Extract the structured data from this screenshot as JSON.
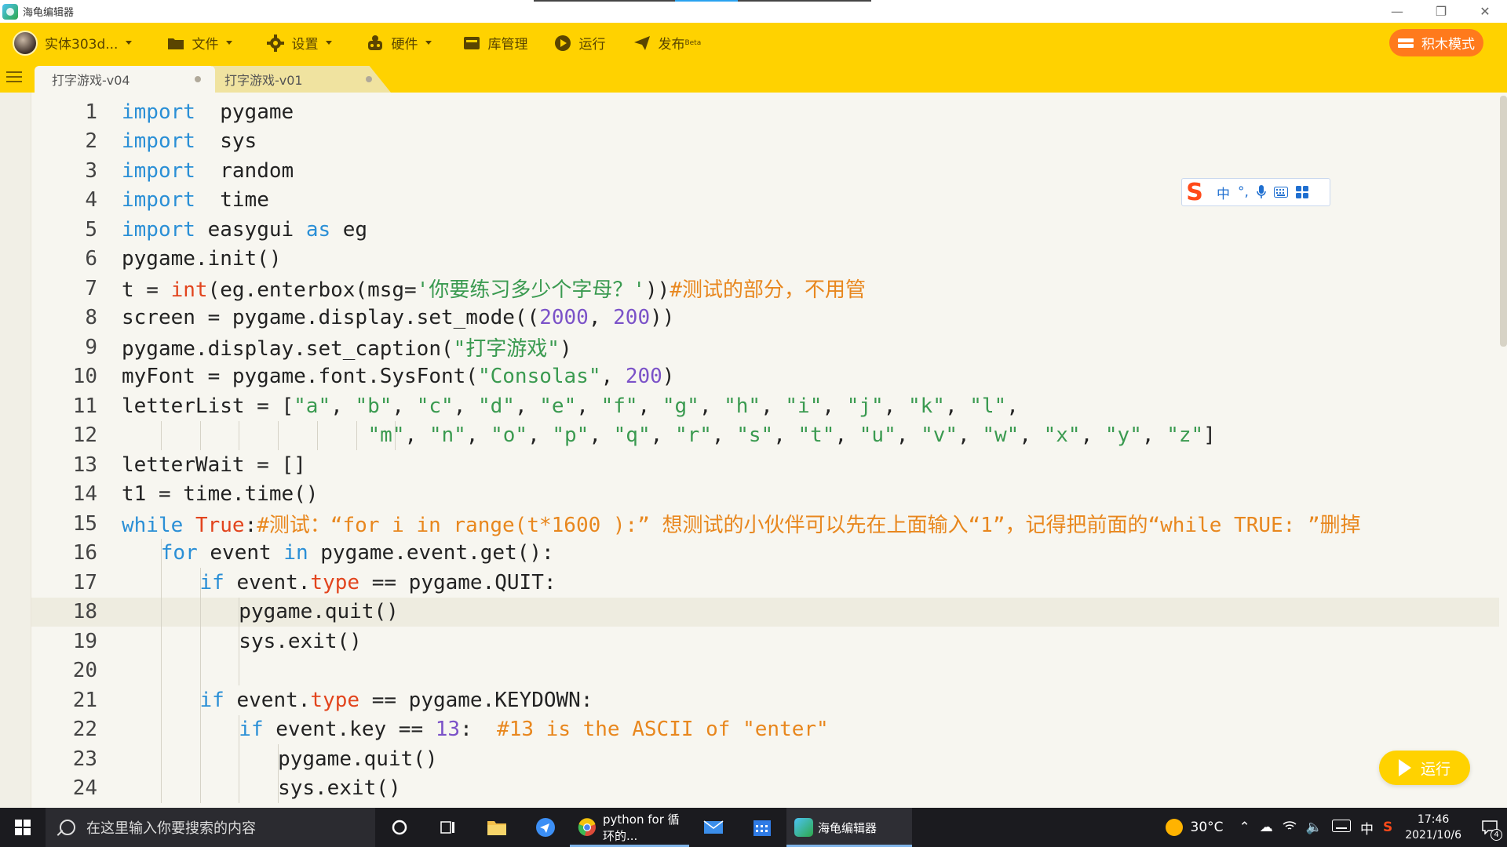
{
  "window": {
    "title": "海龟编辑器"
  },
  "toolbar": {
    "project_label": "实体303d...",
    "file_label": "文件",
    "settings_label": "设置",
    "hardware_label": "硬件",
    "library_label": "库管理",
    "run_label": "运行",
    "publish_label": "发布",
    "publish_badge": "Beta",
    "blocks_mode_label": "积木模式"
  },
  "tabs": [
    {
      "label": "打字游戏-v04",
      "active": true
    },
    {
      "label": "打字游戏-v01",
      "active": false
    }
  ],
  "editor": {
    "current_line": 18,
    "lines": [
      {
        "n": "1",
        "indent": 0,
        "tokens": [
          [
            "kw",
            "import"
          ],
          [
            "",
            "  pygame"
          ]
        ]
      },
      {
        "n": "2",
        "indent": 0,
        "tokens": [
          [
            "kw",
            "import"
          ],
          [
            "",
            "  sys"
          ]
        ]
      },
      {
        "n": "3",
        "indent": 0,
        "tokens": [
          [
            "kw",
            "import"
          ],
          [
            "",
            "  random"
          ]
        ]
      },
      {
        "n": "4",
        "indent": 0,
        "tokens": [
          [
            "kw",
            "import"
          ],
          [
            "",
            "  time"
          ]
        ]
      },
      {
        "n": "5",
        "indent": 0,
        "tokens": [
          [
            "kw",
            "import"
          ],
          [
            "",
            " easygui "
          ],
          [
            "kw",
            "as"
          ],
          [
            "",
            " eg"
          ]
        ]
      },
      {
        "n": "6",
        "indent": 0,
        "tokens": [
          [
            "",
            "pygame.init()"
          ]
        ]
      },
      {
        "n": "7",
        "indent": 0,
        "tokens": [
          [
            "",
            "t = "
          ],
          [
            "fn",
            "int"
          ],
          [
            "",
            "(eg.enterbox(msg="
          ],
          [
            "str",
            "'你要练习多少个字母？'"
          ],
          [
            "",
            "))"
          ],
          [
            "cmt",
            "#测试的部分，不用管"
          ]
        ]
      },
      {
        "n": "8",
        "indent": 0,
        "tokens": [
          [
            "",
            "screen = pygame.display.set_mode(("
          ],
          [
            "num",
            "2000"
          ],
          [
            "",
            ", "
          ],
          [
            "num",
            "200"
          ],
          [
            "",
            "))"
          ]
        ]
      },
      {
        "n": "9",
        "indent": 0,
        "tokens": [
          [
            "",
            "pygame.display.set_caption("
          ],
          [
            "str",
            "\"打字游戏\""
          ],
          [
            "",
            ")"
          ]
        ]
      },
      {
        "n": "10",
        "indent": 0,
        "tokens": [
          [
            "",
            "myFont = pygame.font.SysFont("
          ],
          [
            "str",
            "\"Consolas\""
          ],
          [
            "",
            ", "
          ],
          [
            "num",
            "200"
          ],
          [
            "",
            ")"
          ]
        ]
      },
      {
        "n": "11",
        "indent": 0,
        "tokens": [
          [
            "",
            "letterList = ["
          ],
          [
            "str",
            "\"a\""
          ],
          [
            "",
            ", "
          ],
          [
            "str",
            "\"b\""
          ],
          [
            "",
            ", "
          ],
          [
            "str",
            "\"c\""
          ],
          [
            "",
            ", "
          ],
          [
            "str",
            "\"d\""
          ],
          [
            "",
            ", "
          ],
          [
            "str",
            "\"e\""
          ],
          [
            "",
            ", "
          ],
          [
            "str",
            "\"f\""
          ],
          [
            "",
            ", "
          ],
          [
            "str",
            "\"g\""
          ],
          [
            "",
            ", "
          ],
          [
            "str",
            "\"h\""
          ],
          [
            "",
            ", "
          ],
          [
            "str",
            "\"i\""
          ],
          [
            "",
            ", "
          ],
          [
            "str",
            "\"j\""
          ],
          [
            "",
            ", "
          ],
          [
            "str",
            "\"k\""
          ],
          [
            "",
            ", "
          ],
          [
            "str",
            "\"l\""
          ],
          [
            "",
            ","
          ]
        ]
      },
      {
        "n": "12",
        "indent": 7,
        "tokens": [
          [
            "str",
            "\"m\""
          ],
          [
            "",
            ", "
          ],
          [
            "str",
            "\"n\""
          ],
          [
            "",
            ", "
          ],
          [
            "str",
            "\"o\""
          ],
          [
            "",
            ", "
          ],
          [
            "str",
            "\"p\""
          ],
          [
            "",
            ", "
          ],
          [
            "str",
            "\"q\""
          ],
          [
            "",
            ", "
          ],
          [
            "str",
            "\"r\""
          ],
          [
            "",
            ", "
          ],
          [
            "str",
            "\"s\""
          ],
          [
            "",
            ", "
          ],
          [
            "str",
            "\"t\""
          ],
          [
            "",
            ", "
          ],
          [
            "str",
            "\"u\""
          ],
          [
            "",
            ", "
          ],
          [
            "str",
            "\"v\""
          ],
          [
            "",
            ", "
          ],
          [
            "str",
            "\"w\""
          ],
          [
            "",
            ", "
          ],
          [
            "str",
            "\"x\""
          ],
          [
            "",
            ", "
          ],
          [
            "str",
            "\"y\""
          ],
          [
            "",
            ", "
          ],
          [
            "str",
            "\"z\""
          ],
          [
            "",
            "]"
          ]
        ]
      },
      {
        "n": "13",
        "indent": 0,
        "tokens": [
          [
            "",
            "letterWait = []"
          ]
        ]
      },
      {
        "n": "14",
        "indent": 0,
        "tokens": [
          [
            "",
            "t1 = time.time()"
          ]
        ]
      },
      {
        "n": "15",
        "indent": 0,
        "tokens": [
          [
            "kw",
            "while"
          ],
          [
            "",
            " "
          ],
          [
            "fn",
            "True"
          ],
          [
            "",
            ":"
          ],
          [
            "cmt",
            "#测试：“for i in range(t*1600 ):” 想测试的小伙伴可以先在上面输入“1”，记得把前面的“while TRUE: ”删掉"
          ]
        ]
      },
      {
        "n": "16",
        "indent": 1,
        "tokens": [
          [
            "kw",
            "for"
          ],
          [
            "",
            " event "
          ],
          [
            "kw",
            "in"
          ],
          [
            "",
            " pygame.event.get():"
          ]
        ]
      },
      {
        "n": "17",
        "indent": 2,
        "tokens": [
          [
            "kw",
            "if"
          ],
          [
            "",
            " event."
          ],
          [
            "fn",
            "type"
          ],
          [
            "",
            " == pygame.QUIT:"
          ]
        ]
      },
      {
        "n": "18",
        "indent": 3,
        "tokens": [
          [
            "",
            "pygame.quit()"
          ]
        ]
      },
      {
        "n": "19",
        "indent": 3,
        "tokens": [
          [
            "",
            "sys.exit()"
          ]
        ]
      },
      {
        "n": "20",
        "indent": 3,
        "tokens": []
      },
      {
        "n": "21",
        "indent": 2,
        "tokens": [
          [
            "kw",
            "if"
          ],
          [
            "",
            " event."
          ],
          [
            "fn",
            "type"
          ],
          [
            "",
            " == pygame.KEYDOWN:"
          ]
        ]
      },
      {
        "n": "22",
        "indent": 3,
        "tokens": [
          [
            "kw",
            "if"
          ],
          [
            "",
            " event.key == "
          ],
          [
            "num",
            "13"
          ],
          [
            "",
            ":  "
          ],
          [
            "cmt",
            "#13 is the ASCII of \"enter\""
          ]
        ]
      },
      {
        "n": "23",
        "indent": 4,
        "tokens": [
          [
            "",
            "pygame.quit()"
          ]
        ]
      },
      {
        "n": "24",
        "indent": 4,
        "tokens": [
          [
            "",
            "sys.exit()"
          ]
        ]
      }
    ]
  },
  "ime": {
    "logo": "S",
    "mode": "中",
    "punct": "°,"
  },
  "run_button_label": "运行",
  "taskbar": {
    "search_placeholder": "在这里输入你要搜索的内容",
    "chrome_label": "python for 循环的...",
    "editor_label": "海龟编辑器",
    "weather": "30°C",
    "ime_indicator": "中",
    "time": "17:46",
    "date": "2021/10/6",
    "notification_count": "4"
  },
  "colors": {
    "accent": "#ffd200",
    "keyword": "#2a8fd6",
    "builtin": "#e2441d",
    "string": "#3a9a50",
    "number": "#7b52c8",
    "comment": "#e8871e"
  }
}
